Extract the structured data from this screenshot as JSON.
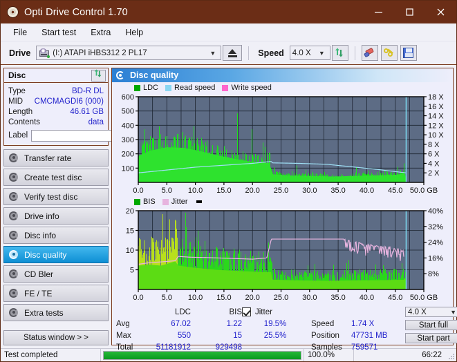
{
  "window": {
    "title": "Opti Drive Control 1.70",
    "icon": "disc-icon",
    "controls": {
      "minimize": "—",
      "maximize": "☐",
      "close": "✕"
    }
  },
  "menu": {
    "items": [
      "File",
      "Start test",
      "Extra",
      "Help"
    ]
  },
  "toolbar": {
    "drive_label": "Drive",
    "drive_value": "(I:)  ATAPI iHBS312  2 PL17",
    "eject_icon": "eject-icon",
    "speed_label": "Speed",
    "speed_value": "4.0 X",
    "refresh_icon": "refresh-icon",
    "eraser_icon": "eraser-icon",
    "tools_icon": "spanner-icon",
    "save_icon": "floppy-save-icon"
  },
  "disc_panel": {
    "title": "Disc",
    "refresh_icon": "refresh-icon",
    "rows": [
      {
        "key": "Type",
        "value": "BD-R DL"
      },
      {
        "key": "MID",
        "value": "CMCMAGDI6 (000)"
      },
      {
        "key": "Length",
        "value": "46.61 GB"
      },
      {
        "key": "Contents",
        "value": "data"
      }
    ],
    "label_key": "Label",
    "label_value": "",
    "label_placeholder": "",
    "disc_icon": "cd-icon"
  },
  "nav": {
    "items": [
      {
        "label": "Transfer rate",
        "icon": "disc-test-icon",
        "active": false
      },
      {
        "label": "Create test disc",
        "icon": "disc-test-icon",
        "active": false
      },
      {
        "label": "Verify test disc",
        "icon": "disc-test-icon",
        "active": false
      },
      {
        "label": "Drive info",
        "icon": "disc-test-icon",
        "active": false
      },
      {
        "label": "Disc info",
        "icon": "disc-test-icon",
        "active": false
      },
      {
        "label": "Disc quality",
        "icon": "disc-test-icon",
        "active": true
      },
      {
        "label": "CD Bler",
        "icon": "disc-test-icon",
        "active": false
      },
      {
        "label": "FE / TE",
        "icon": "disc-test-icon",
        "active": false
      },
      {
        "label": "Extra tests",
        "icon": "disc-test-icon",
        "active": false
      }
    ],
    "status_window_button": "Status window > >"
  },
  "panel": {
    "title": "Disc quality",
    "icon": "disc-quality-icon"
  },
  "stats": {
    "col_headers": [
      "LDC",
      "BIS"
    ],
    "row_headers": [
      "Avg",
      "Max",
      "Total"
    ],
    "ldc": {
      "avg": "67.02",
      "max": "550",
      "total": "51181912"
    },
    "bis": {
      "avg": "1.22",
      "max": "15",
      "total": "929498"
    },
    "jitter": {
      "label": "Jitter",
      "checked": true,
      "avg": "19.5%",
      "max": "25.5%"
    },
    "right": [
      {
        "key": "Speed",
        "value": "1.74 X"
      },
      {
        "key": "Position",
        "value": "47731 MB"
      },
      {
        "key": "Samples",
        "value": "759571"
      }
    ],
    "speed_select": "4.0 X",
    "start_full_button": "Start full",
    "start_part_button": "Start part"
  },
  "statusbar": {
    "text": "Test completed",
    "progress_percent": "100.0%",
    "progress_value": 100,
    "elapsed": "66:22"
  },
  "chart_data": [
    {
      "type": "area",
      "id": "ldc-chart",
      "title": "Disc quality",
      "xlabel": "GB",
      "ylabel": "LDC",
      "xlim": [
        0,
        50
      ],
      "ylim": [
        0,
        600
      ],
      "xticks": [
        "0.0",
        "5.0",
        "10.0",
        "15.0",
        "20.0",
        "25.0",
        "30.0",
        "35.0",
        "40.0",
        "45.0",
        "50.0 GB"
      ],
      "yticks": [
        100,
        200,
        300,
        400,
        500,
        600
      ],
      "y2ticks": [
        "2 X",
        "4 X",
        "6 X",
        "8 X",
        "10 X",
        "12 X",
        "14 X",
        "16 X",
        "18 X"
      ],
      "y2lim": [
        0,
        18
      ],
      "grid": true,
      "legend": [
        {
          "name": "LDC",
          "color": "#00cc00"
        },
        {
          "name": "Read speed",
          "color": "#7fd4f0"
        },
        {
          "name": "Write speed",
          "color": "#ff66cc"
        }
      ],
      "series": [
        {
          "name": "LDC",
          "color": "#22dd22",
          "note": "Dense green spike field. Baseline envelope rises from ~220 at 0GB to a broad hump peaking ~300 near 5-9GB, decaying to ~170 by 20GB. Frequent spikes to 300-560. After 23.3GB the baseline drops sharply to ~40-80 with scattered spikes reaching 200-470.",
          "envelope_x": [
            0,
            2,
            5,
            8,
            11,
            14,
            17,
            20,
            23,
            23.4,
            26,
            30,
            34,
            38,
            42,
            45,
            46.9
          ],
          "envelope_y": [
            225,
            270,
            300,
            295,
            265,
            230,
            200,
            175,
            165,
            70,
            60,
            55,
            50,
            55,
            60,
            65,
            75
          ],
          "max_spikes": [
            550,
            470,
            460,
            440,
            430,
            420,
            400,
            390
          ]
        },
        {
          "name": "Read speed",
          "color": "#9fe0f5",
          "note": "Light blue stepped line. Rises from ~2.0X at 0GB to ~4.4X at 23.3GB, small step down, then gently falls to ~2.0X by 46.9GB. Vertical cyan line at 46.9GB spanning full height.",
          "x": [
            0,
            5,
            10,
            15,
            20,
            23.3,
            23.5,
            28,
            33,
            38,
            42,
            46.9
          ],
          "y": [
            2.0,
            2.6,
            3.2,
            3.6,
            4.0,
            4.4,
            4.1,
            4.0,
            3.8,
            3.2,
            2.7,
            2.0
          ]
        },
        {
          "name": "Write speed",
          "color": "#ff66cc",
          "x": [],
          "y": []
        }
      ]
    },
    {
      "type": "area",
      "id": "bis-chart",
      "xlabel": "GB",
      "ylabel": "BIS",
      "xlim": [
        0,
        50
      ],
      "ylim": [
        0,
        20
      ],
      "xticks": [
        "0.0",
        "5.0",
        "10.0",
        "15.0",
        "20.0",
        "25.0",
        "30.0",
        "35.0",
        "40.0",
        "45.0",
        "50.0 GB"
      ],
      "yticks": [
        5,
        10,
        15,
        20
      ],
      "y2ticks": [
        "8%",
        "16%",
        "24%",
        "32%",
        "40%"
      ],
      "y2lim": [
        0,
        40
      ],
      "grid": true,
      "legend": [
        {
          "name": "BIS",
          "color": "#00cc00"
        },
        {
          "name": "Jitter",
          "color": "#e9b8e0"
        }
      ],
      "series": [
        {
          "name": "BIS",
          "color": "#5cdc14",
          "note": "Dense green/yellow-green spike field. Baseline ~6-13 from 0 to 6.5GB with spikes to 15, ~5-12 from 7 to 23.3GB decaying, then drops to ~2-5 with occasional spikes to 9 after 23.3GB.",
          "envelope_x": [
            0,
            2,
            4,
            6.5,
            7,
            10,
            14,
            18,
            22,
            23.3,
            23.5,
            28,
            33,
            38,
            43,
            46.5,
            46.9
          ],
          "envelope_y": [
            11,
            11.5,
            11,
            13,
            11,
            10,
            9,
            8.5,
            8,
            8,
            4.5,
            4.2,
            4.0,
            4.2,
            4.3,
            4.5,
            6
          ]
        },
        {
          "name": "Jitter",
          "color": "#e7b4df",
          "note": "Pink line. Starts ~6.4 (12.8%) at 0GB, rises to ~8.4 (16.8%) by 7GB, flat ~8.0 until 22GB, jumps at 23.3GB to ~12.8 (25.5%) flat to ~36GB then becomes noisy oscillating 9.8-12.8 until 46.5GB.",
          "x": [
            0,
            2,
            4,
            6.5,
            7,
            9,
            12,
            16,
            20,
            22.5,
            23.3,
            28,
            33,
            36,
            40,
            44,
            46.5
          ],
          "y": [
            6.4,
            6.8,
            7.0,
            7.3,
            8.4,
            8.2,
            8.1,
            7.9,
            7.7,
            8.0,
            12.8,
            12.8,
            12.8,
            12.8,
            11.5,
            11.0,
            10.0
          ]
        }
      ]
    }
  ]
}
